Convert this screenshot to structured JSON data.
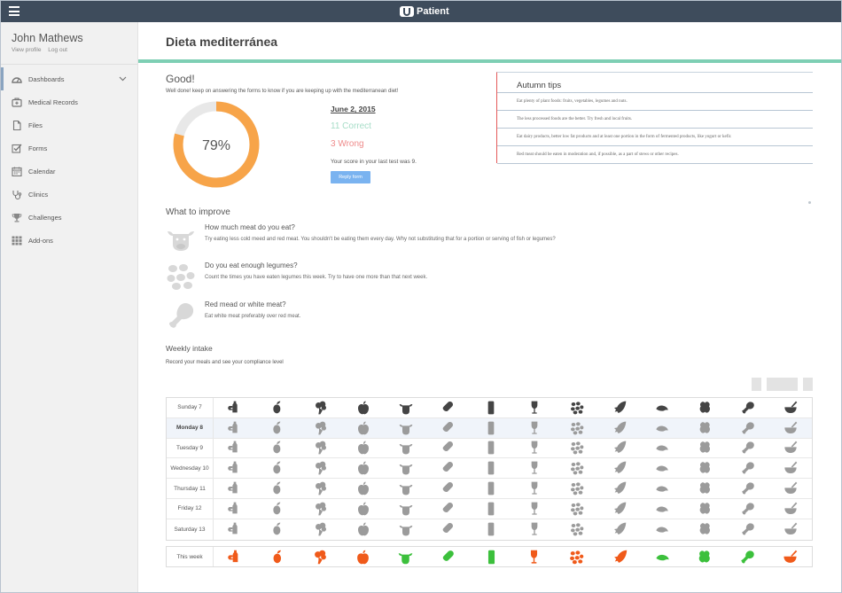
{
  "app": {
    "brand": "Patient",
    "menu_icon": "hamburger-icon",
    "logo_icon": "u-logo-icon"
  },
  "profile": {
    "name": "John Mathews",
    "view_profile": "View profile",
    "log_out": "Log out"
  },
  "sidebar": {
    "items": [
      {
        "label": "Dashboards",
        "icon": "dashboard-icon"
      },
      {
        "label": "Medical Records",
        "icon": "medical-kit-icon"
      },
      {
        "label": "Files",
        "icon": "file-icon"
      },
      {
        "label": "Forms",
        "icon": "checkbox-icon"
      },
      {
        "label": "Calendar",
        "icon": "calendar-icon"
      },
      {
        "label": "Clinics",
        "icon": "stethoscope-icon"
      },
      {
        "label": "Challenges",
        "icon": "trophy-icon"
      },
      {
        "label": "Add-ons",
        "icon": "grid-icon"
      }
    ]
  },
  "page": {
    "title": "Dieta mediterránea"
  },
  "score": {
    "heading": "Good!",
    "subtitle": "Well done! keep on answering the forms to know if you are keeping up with the mediterranean diet!",
    "percent_label": "79%",
    "percent": 79,
    "date": "June 2, 2015",
    "correct": "11 Correct",
    "wrong": "3 Wrong",
    "last_score": "Your score in your last test was 9.",
    "reply_button": "Reply form"
  },
  "tips": {
    "title": "Autumn tips",
    "items": [
      "Eat plenty of plant foods: fruits, vegetables, legumes and nuts.",
      "The less processed foods are the better. Try fresh and local fruits.",
      "Eat dairy products, better low fat products and at least one portion in the form of fermented products, like yogurt or kefir.",
      "Red meat should be eaten in moderation and, if possible, as a part of stews or other recipes."
    ]
  },
  "improve": {
    "heading": "What to improve",
    "items": [
      {
        "question": "How much meat do you eat?",
        "tip": "Try eating less cold meed and red meat. You shouldn't be eating them every day. Why not substituting that for a portion or serving of fish or legumes?",
        "icon": "cow-icon"
      },
      {
        "question": "Do you eat enough legumes?",
        "tip": "Count the times you have eaten legumes this week. Try to have one more than that next week.",
        "icon": "legumes-icon"
      },
      {
        "question": "Red mead or white meat?",
        "tip": "Eat white meat preferably over red meat.",
        "icon": "chicken-leg-icon"
      }
    ]
  },
  "weekly": {
    "heading": "Weekly intake",
    "subtitle": "Record your meals and see your compliance level",
    "pager": [
      "",
      "",
      ""
    ],
    "days": [
      "Sunday 7",
      "Monday 8",
      "Tuesday 9",
      "Wednesday 10",
      "Thursday 11",
      "Friday 12",
      "Saturday 13"
    ],
    "summary_label": "This week",
    "food_icons": [
      "olive-oil-icon",
      "olive-icon",
      "broccoli-icon",
      "apple-icon",
      "cow-icon",
      "bread-icon",
      "milk-icon",
      "wine-glass-icon",
      "legumes-icon",
      "fish-icon",
      "shrimp-icon",
      "nuts-icon",
      "chicken-leg-icon",
      "mortar-icon"
    ],
    "summary_colors": [
      "#f05a1a",
      "#f05a1a",
      "#f05a1a",
      "#f05a1a",
      "#3cc03c",
      "#3cc03c",
      "#3cc03c",
      "#f05a1a",
      "#f05a1a",
      "#f05a1a",
      "#3cc03c",
      "#3cc03c",
      "#3cc03c",
      "#f05a1a"
    ]
  },
  "colors": {
    "donut_fill": "#f7a449",
    "donut_track": "#e8e8e8",
    "topbar": "#3e4c5c",
    "accent_rule": "#7ecfb4",
    "icon_gray": "#9b9b9b",
    "icon_dark": "#444444"
  }
}
